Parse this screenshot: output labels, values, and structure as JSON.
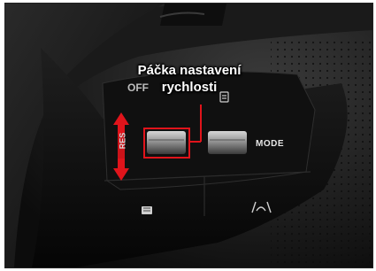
{
  "callout": {
    "line1": "Páčka nastavení",
    "line2": "rychlosti"
  },
  "engraved": {
    "off": "OFF",
    "res": "RES",
    "mode": "MODE"
  },
  "icons": [
    "steering-wheel-photo",
    "up-arrow-icon",
    "down-arrow-icon",
    "lane-assist-icon",
    "heated-wheel-icon",
    "distance-icon"
  ],
  "colors": {
    "arrow": "#e0141b",
    "highlight": "#e0141b",
    "text": "#ffffff"
  }
}
